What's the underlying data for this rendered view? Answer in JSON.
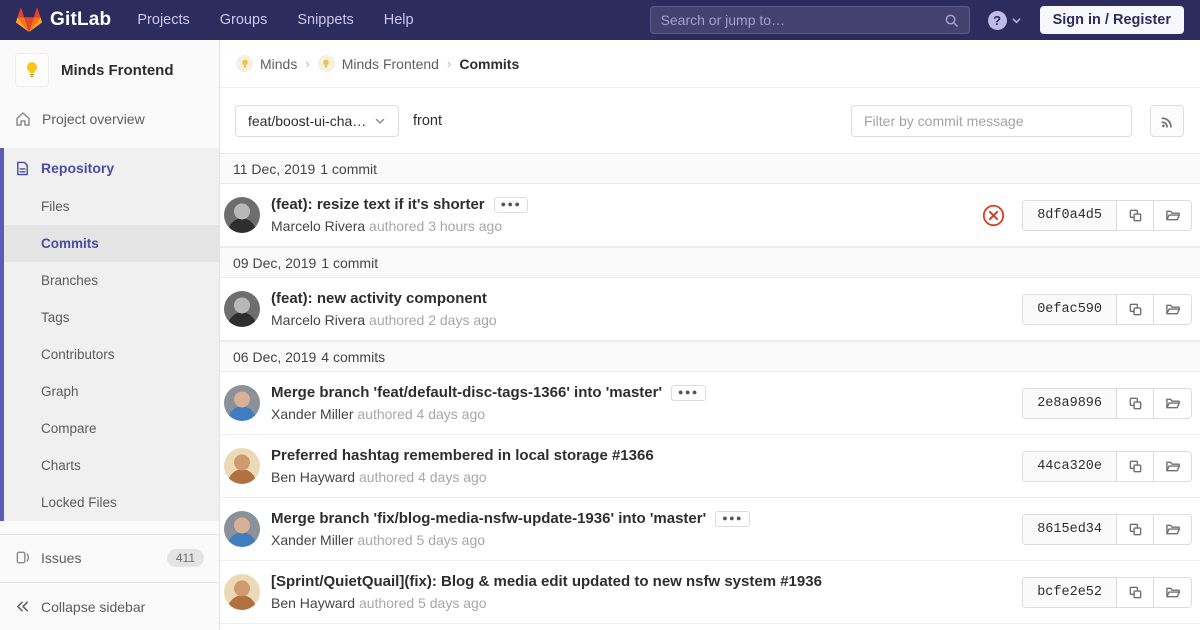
{
  "colors": {
    "navbar_bg": "#2e2c5e",
    "accent_indigo": "#4b4ba3",
    "brand_red": "#e24329",
    "brand_orange": "#fc6d26",
    "brand_yellow": "#fca326",
    "failed_red": "#db3b21"
  },
  "navbar": {
    "brand": "GitLab",
    "links": [
      "Projects",
      "Groups",
      "Snippets",
      "Help"
    ],
    "search_placeholder": "Search or jump to…",
    "help_glyph": "?",
    "signin_label": "Sign in / Register"
  },
  "sidebar": {
    "project_name": "Minds Frontend",
    "overview_label": "Project overview",
    "repository_label": "Repository",
    "repo_items": [
      {
        "label": "Files",
        "active": false
      },
      {
        "label": "Commits",
        "active": true
      },
      {
        "label": "Branches",
        "active": false
      },
      {
        "label": "Tags",
        "active": false
      },
      {
        "label": "Contributors",
        "active": false
      },
      {
        "label": "Graph",
        "active": false
      },
      {
        "label": "Compare",
        "active": false
      },
      {
        "label": "Charts",
        "active": false
      },
      {
        "label": "Locked Files",
        "active": false
      }
    ],
    "issues_label": "Issues",
    "issues_count": "411",
    "collapse_label": "Collapse sidebar"
  },
  "breadcrumb": {
    "items": [
      "Minds",
      "Minds Frontend"
    ],
    "separator": "›",
    "current": "Commits"
  },
  "controls": {
    "branch": "feat/boost-ui-cha…",
    "ref_path": "front",
    "filter_placeholder": "Filter by commit message"
  },
  "commits": {
    "groups": [
      {
        "date": "11 Dec, 2019",
        "count": "1 commit",
        "commits": [
          {
            "title": "(feat): resize text if it's shorter",
            "has_ellipsis": true,
            "author": "Marcelo Rivera",
            "authored": "authored 3 hours ago",
            "sha": "8df0a4d5",
            "status": "failed",
            "avatar": [
              "#6e6e6e",
              "#b8b8b8",
              "#2e2e2e"
            ]
          }
        ]
      },
      {
        "date": "09 Dec, 2019",
        "count": "1 commit",
        "commits": [
          {
            "title": "(feat): new activity component",
            "has_ellipsis": false,
            "author": "Marcelo Rivera",
            "authored": "authored 2 days ago",
            "sha": "0efac590",
            "status": "none",
            "avatar": [
              "#6e6e6e",
              "#b8b8b8",
              "#2e2e2e"
            ]
          }
        ]
      },
      {
        "date": "06 Dec, 2019",
        "count": "4 commits",
        "commits": [
          {
            "title": "Merge branch 'feat/default-disc-tags-1366' into 'master'",
            "has_ellipsis": true,
            "author": "Xander Miller",
            "authored": "authored 4 days ago",
            "sha": "2e8a9896",
            "status": "none",
            "avatar": [
              "#8b9199",
              "#d8b094",
              "#3f7cc0"
            ]
          },
          {
            "title": "Preferred hashtag remembered in local storage #1366",
            "has_ellipsis": false,
            "author": "Ben Hayward",
            "authored": "authored 4 days ago",
            "sha": "44ca320e",
            "status": "none",
            "avatar": [
              "#ecd9b6",
              "#cf9a70",
              "#b0703f"
            ]
          },
          {
            "title": "Merge branch 'fix/blog-media-nsfw-update-1936' into 'master'",
            "has_ellipsis": true,
            "author": "Xander Miller",
            "authored": "authored 5 days ago",
            "sha": "8615ed34",
            "status": "none",
            "avatar": [
              "#8b9199",
              "#d8b094",
              "#3f7cc0"
            ]
          },
          {
            "title": "[Sprint/QuietQuail](fix): Blog & media edit updated to new nsfw system #1936",
            "has_ellipsis": false,
            "author": "Ben Hayward",
            "authored": "authored 5 days ago",
            "sha": "bcfe2e52",
            "status": "none",
            "avatar": [
              "#ecd9b6",
              "#cf9a70",
              "#b0703f"
            ]
          }
        ]
      }
    ]
  }
}
